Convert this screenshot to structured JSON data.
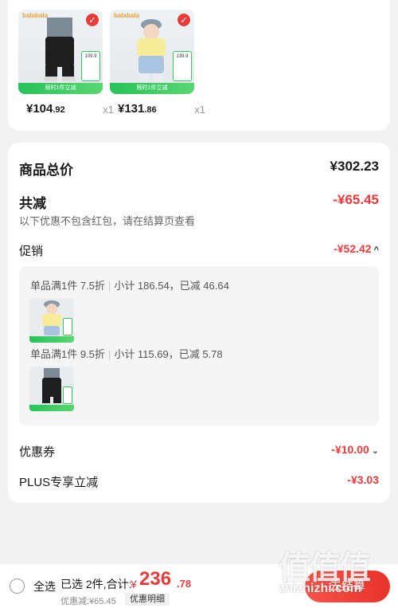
{
  "products": [
    {
      "brand": "balabala",
      "promo_strip": "限时1件立减",
      "price_int": "¥104",
      "price_dec": ".92",
      "qty": "x1",
      "tag_price": "109.9"
    },
    {
      "brand": "balabala",
      "promo_strip": "限时1件立减",
      "price_int": "¥131",
      "price_dec": ".86",
      "qty": "x1",
      "tag_price": "139.9"
    }
  ],
  "summary": {
    "total_label": "商品总价",
    "total_value": "¥302.23",
    "reduce_label": "共减",
    "reduce_value": "-¥65.45",
    "reduce_note": "以下优惠不包含红包，请在结算页查看",
    "promo_label": "促销",
    "promo_value": "-¥52.42",
    "promo_items": [
      {
        "rule": "单品满1件 7.5折",
        "subtotal": "小计 186.54，已减 46.64"
      },
      {
        "rule": "单品满1件 9.5折",
        "subtotal": "小计 115.69，已减 5.78"
      }
    ],
    "coupon_label": "优惠券",
    "coupon_value": "-¥10.00",
    "plus_label": "PLUS专享立减",
    "plus_value": "-¥3.03"
  },
  "bottom_bar": {
    "select_all": "全选",
    "selected": "已选 2件,合计:",
    "currency": "¥",
    "total_int": "236",
    "total_dec": ".78",
    "discount": "优惠减:¥65.45",
    "detail_button": "优惠明细",
    "checkout_button": "去结算"
  },
  "watermark": {
    "glyphs": "值值值",
    "domain": "zhizhizhi.com"
  },
  "colors": {
    "accent_red": "#e93b3b",
    "promo_green": "#27c25a",
    "brand_orange": "#e7a234"
  }
}
